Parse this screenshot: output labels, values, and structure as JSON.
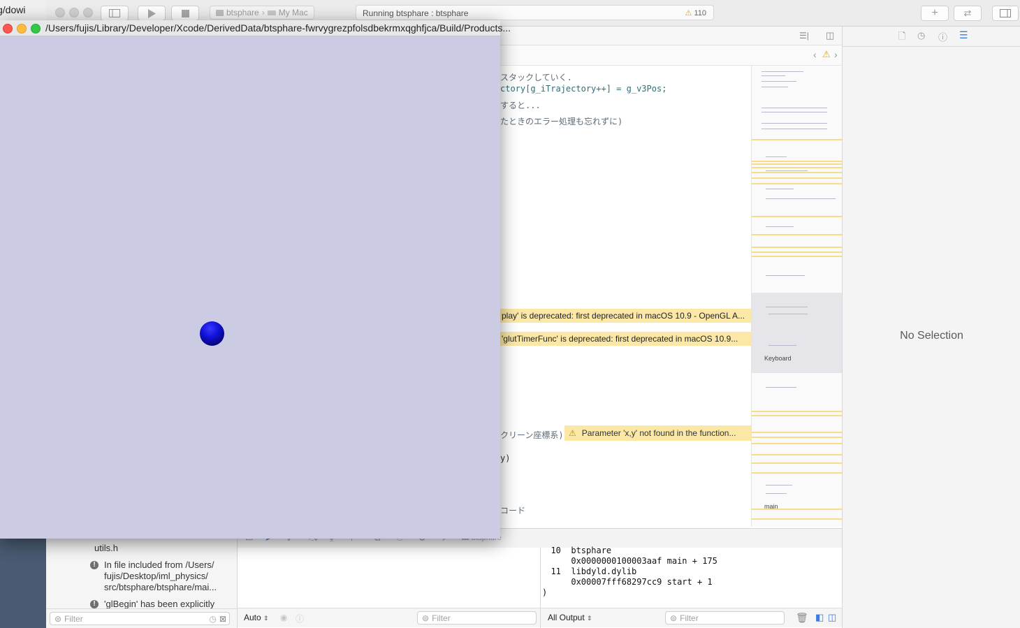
{
  "browser_strip": {
    "text": "g/dowi"
  },
  "xcode": {
    "scheme": {
      "target": "btsphare",
      "destination": "My Mac"
    },
    "activity": {
      "status": "Running btsphare : btsphare",
      "warning_count": "110"
    },
    "code_lines": [
      {
        "text": "スタックしていく.",
        "kind": "comment"
      },
      {
        "text": "ctory[g_iTrajectory++] = g_v3Pos;",
        "kind": "code"
      },
      {
        "text": "すると...",
        "kind": "comment"
      },
      {
        "text": "たときのエラー処理も忘れずに)",
        "kind": "comment"
      }
    ],
    "issues": [
      {
        "text": "play' is deprecated: first deprecated in macOS 10.9 - OpenGL A..."
      },
      {
        "text": "'glutTimerFunc' is deprecated: first deprecated in macOS 10.9..."
      }
    ],
    "code_tail": [
      {
        "text": "クリーン座標系)",
        "kind": "comment"
      },
      {
        "text": "y)",
        "kind": "code"
      },
      {
        "text": "コード",
        "kind": "comment"
      }
    ],
    "inline_warning": "Parameter 'x,y' not found in the function...",
    "minimap_labels": {
      "keyboard": "Keyboard",
      "main": "main"
    },
    "inspector": {
      "empty_label": "No Selection"
    },
    "debug_bar": {
      "process": "btsphare"
    },
    "navigator": {
      "items": [
        {
          "text": "utils.h",
          "icon": false
        },
        {
          "text": "In file included from /Users/\nfujis/Desktop/iml_physics/\nsrc/btsphare/btsphare/mai...",
          "icon": true
        },
        {
          "text": "'glBegin' has been explicitly",
          "icon": true
        }
      ],
      "filter_placeholder": "Filter"
    },
    "variables": {
      "scope": "Auto",
      "filter_placeholder": "Filter"
    },
    "console": {
      "lines": [
        "  10  btsphare",
        "      0x0000000100003aaf main + 175",
        "  11  libdyld.dylib",
        "      0x00007fff68297cc9 start + 1",
        ")"
      ],
      "output": "All Output",
      "filter_placeholder": "Filter"
    }
  },
  "glut_window": {
    "title": "/Users/fujis/Library/Developer/Xcode/DerivedData/btsphare-fwrvygrezpfolsdbekrmxqghfjca/Build/Products...",
    "background": "#cbcbe3",
    "sphere_color": "#1212d8"
  }
}
